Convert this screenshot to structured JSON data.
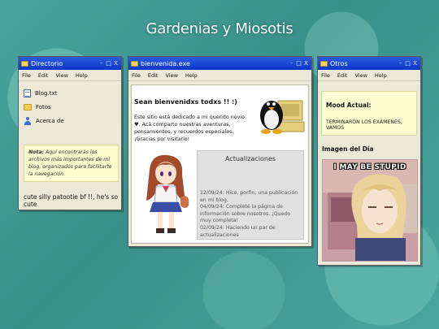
{
  "site_title": "Gardenias y Miosotis",
  "directorio": {
    "title": "Directorio",
    "menu": [
      "File",
      "Edit",
      "View",
      "Help"
    ],
    "files": [
      {
        "name": "Blog.txt",
        "icon": "text-file-icon"
      },
      {
        "name": "Fotos",
        "icon": "folder-icon"
      },
      {
        "name": "Acerca de",
        "icon": "user-icon"
      }
    ],
    "note_label": "Nota:",
    "note_text": " Aquí encontrarás los archivos más importantes de mi blog, organizados para facilitarte la navegación.",
    "footer_text": "cute silly patootie bf !!, he's so cute"
  },
  "bienvenida": {
    "title": "bienvenida.exe",
    "menu": [
      "File",
      "Edit",
      "View",
      "Help"
    ],
    "heading": "Sean bienvenidxs todxs !! :)",
    "paragraph": "Este sitio está dedicado a mi querido novio ♥. Acá comparto nuestras aventuras, pensamientos, y recuerdos especiales. ¡Gracias por visitarlo!",
    "updates_title": "Actualizaciones",
    "updates": [
      "12/09/24: Hice, porfin, una publicación en mi blog.",
      "04/09/24: Completé la página de información sobre nosotros. ¡Quedo muy completa!",
      "02/09/24: Haciendo un par de actualizaciones"
    ]
  },
  "otros": {
    "title": "Otros",
    "menu": [
      "File",
      "Edit",
      "View",
      "Help"
    ],
    "mood_label": "Mood Actual:",
    "mood_value": "TERMINARON LOS EXÁMENES, VAMOS",
    "image_label": "Imagen del Día",
    "image_caption": "I MAY BE STUPID"
  },
  "window_controls": [
    "-",
    "□",
    "X"
  ],
  "colors": {
    "titlebar": "#0a36c9",
    "window_body": "#ece9d8",
    "note_bg": "#fffbd0",
    "background": "#3f9a93"
  }
}
